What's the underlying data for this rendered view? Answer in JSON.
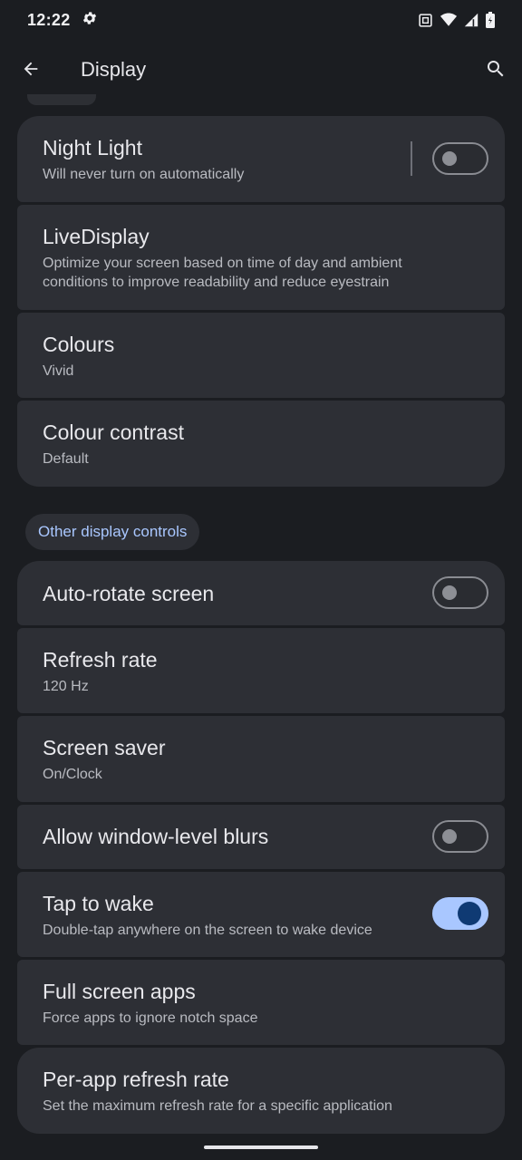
{
  "status_bar": {
    "time": "12:22",
    "icons": [
      "settings-gear-icon",
      "nfc-icon",
      "wifi-icon",
      "signal-icon",
      "battery-icon"
    ]
  },
  "app_bar": {
    "title": "Display",
    "back_icon": "arrow-left-icon",
    "search_icon": "search-icon"
  },
  "group1": {
    "night_light": {
      "title": "Night Light",
      "subtitle": "Will never turn on automatically",
      "enabled": false
    },
    "live_display": {
      "title": "LiveDisplay",
      "subtitle": "Optimize your screen based on time of day and ambient conditions to improve readability and reduce eyestrain"
    },
    "colours": {
      "title": "Colours",
      "subtitle": "Vivid"
    },
    "colour_contrast": {
      "title": "Colour contrast",
      "subtitle": "Default"
    }
  },
  "section_header": "Other display controls",
  "group2": {
    "auto_rotate": {
      "title": "Auto-rotate screen",
      "enabled": false
    },
    "refresh_rate": {
      "title": "Refresh rate",
      "subtitle": "120 Hz"
    },
    "screen_saver": {
      "title": "Screen saver",
      "subtitle": "On/Clock"
    },
    "window_blurs": {
      "title": "Allow window-level blurs",
      "enabled": false
    },
    "tap_to_wake": {
      "title": "Tap to wake",
      "subtitle": "Double-tap anywhere on the screen to wake device",
      "enabled": true
    },
    "full_screen_apps": {
      "title": "Full screen apps",
      "subtitle": "Force apps to ignore notch space"
    },
    "per_app_refresh": {
      "title": "Per-app refresh rate",
      "subtitle": "Set the maximum refresh rate for a specific application"
    }
  },
  "colors": {
    "background": "#1b1d21",
    "card": "#2d2f35",
    "accent": "#a9c7ff",
    "toggle_on_knob": "#0f3a73"
  }
}
